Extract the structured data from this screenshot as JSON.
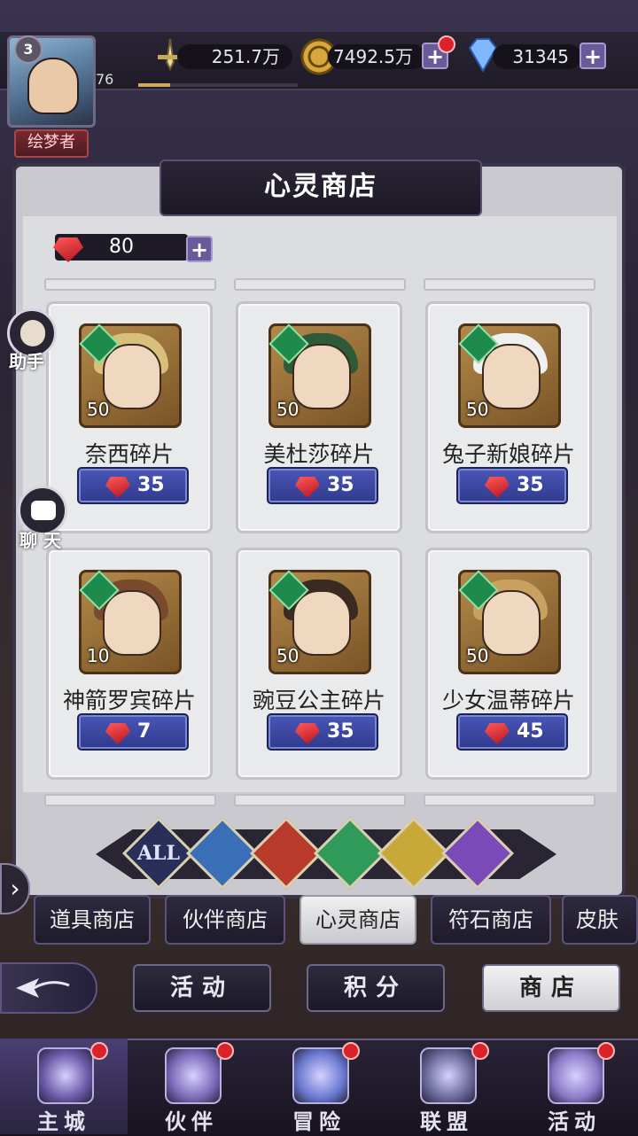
{
  "player": {
    "level": "3",
    "title": "绘梦者",
    "exp_level": "76",
    "exp_progress": 0.2
  },
  "resources": {
    "power": "251.7万",
    "gold": "7492.5万",
    "diamonds": "31345"
  },
  "shop": {
    "title": "心灵商店",
    "currency_amount": "80",
    "items": [
      {
        "name": "奈西碎片",
        "count": "50",
        "price": "35",
        "hair": "#d9c07a"
      },
      {
        "name": "美杜莎碎片",
        "count": "50",
        "price": "35",
        "hair": "#2f5a3a"
      },
      {
        "name": "兔子新娘碎片",
        "count": "50",
        "price": "35",
        "hair": "#f0f0f0"
      },
      {
        "name": "神箭罗宾碎片",
        "count": "10",
        "price": "7",
        "hair": "#7a4a2e"
      },
      {
        "name": "豌豆公主碎片",
        "count": "50",
        "price": "35",
        "hair": "#3a2a22"
      },
      {
        "name": "少女温蒂碎片",
        "count": "50",
        "price": "45",
        "hair": "#c9a060"
      }
    ]
  },
  "filters": [
    {
      "label": "ALL",
      "color": "#2a2f5a"
    },
    {
      "label": "",
      "color": "#3a6fb8"
    },
    {
      "label": "",
      "color": "#b83a2a"
    },
    {
      "label": "",
      "color": "#2f9a5a"
    },
    {
      "label": "",
      "color": "#c9a83a"
    },
    {
      "label": "",
      "color": "#7a4ab8"
    }
  ],
  "shop_tabs": [
    "道具商店",
    "伙伴商店",
    "心灵商店",
    "符石商店",
    "皮肤"
  ],
  "sub_tabs": [
    "活动",
    "积分",
    "商店"
  ],
  "side": {
    "assistant": "助手",
    "chat": "聊 天"
  },
  "nav": [
    "主城",
    "伙伴",
    "冒险",
    "联盟",
    "活动"
  ]
}
